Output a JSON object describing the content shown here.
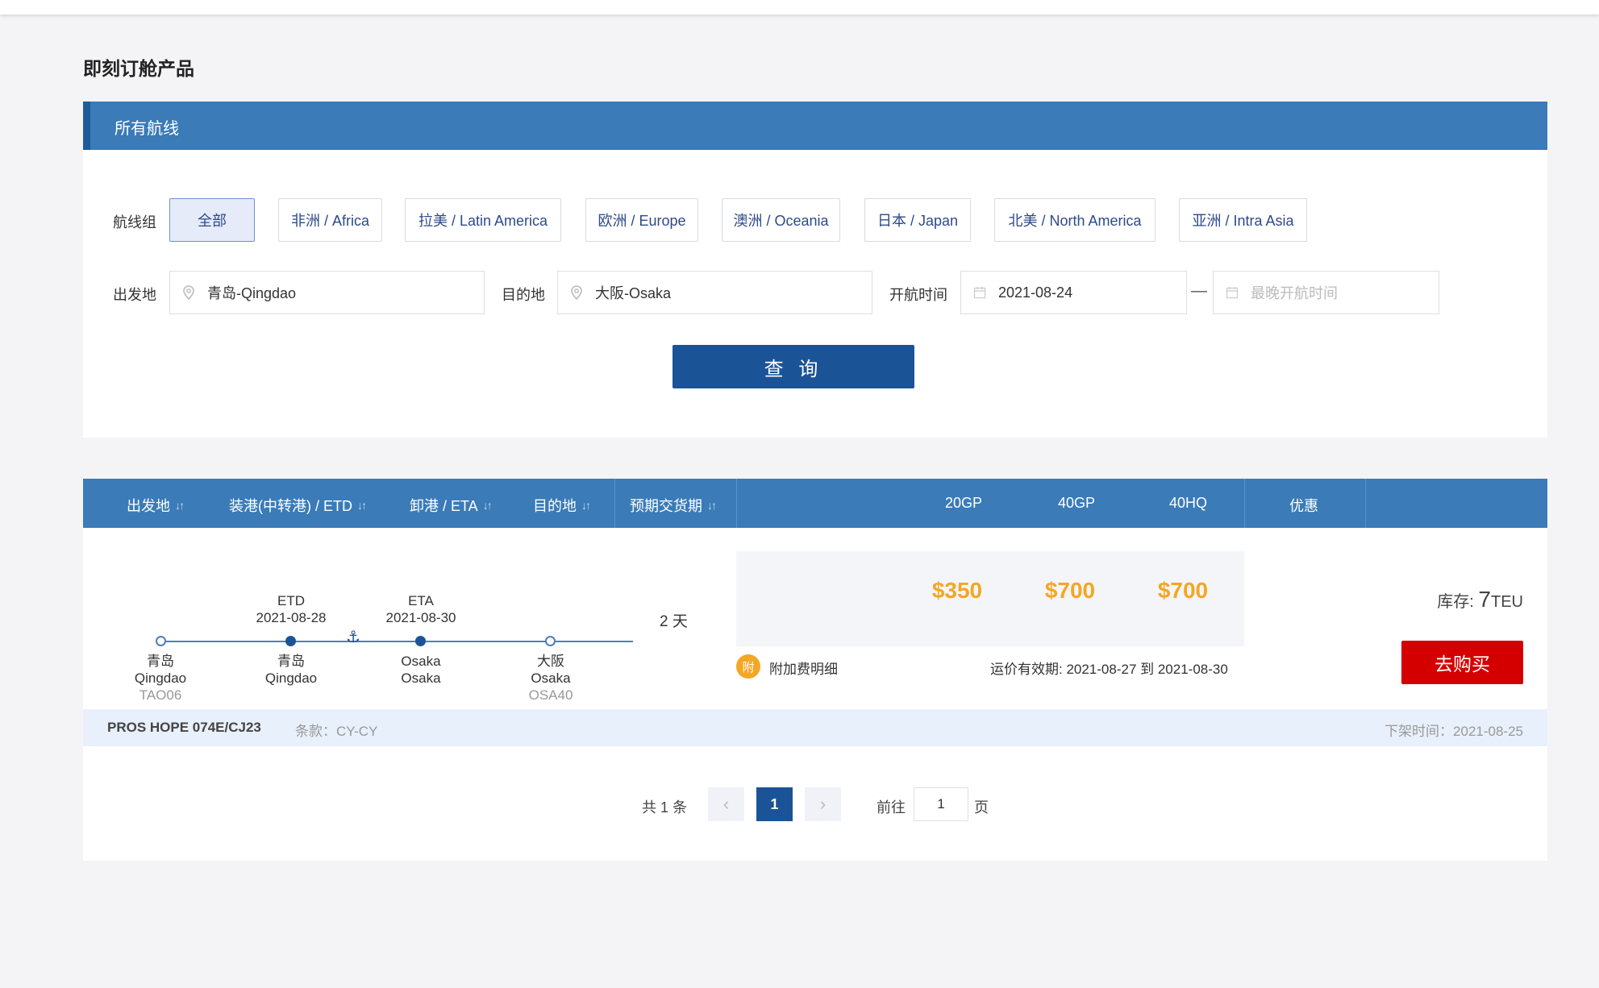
{
  "page": {
    "title": "即刻订舱产品"
  },
  "search": {
    "header": "所有航线",
    "group_label": "航线组",
    "groups": [
      "全部",
      "非洲 / Africa",
      "拉美 / Latin America",
      "欧洲 / Europe",
      "澳洲 / Oceania",
      "日本 / Japan",
      "北美 / North America",
      "亚洲 / Intra Asia"
    ],
    "origin_label": "出发地",
    "origin_value": "青岛-Qingdao",
    "dest_label": "目的地",
    "dest_value": "大阪-Osaka",
    "date_label": "开航时间",
    "date_from": "2021-08-24",
    "date_separator": "—",
    "date_to_placeholder": "最晚开航时间",
    "query_button": "查 询"
  },
  "table": {
    "headers": {
      "origin": "出发地",
      "load_port": "装港(中转港) / ETD",
      "discharge_port": "卸港 / ETA",
      "destination": "目的地",
      "transit": "预期交货期",
      "gp20": "20GP",
      "gp40": "40GP",
      "hq40": "40HQ",
      "discount": "优惠"
    },
    "sort_icon": "↓↑",
    "row": {
      "origin": {
        "cn": "青岛",
        "en": "Qingdao",
        "code": "TAO06"
      },
      "etd_label": "ETD",
      "etd_date": "2021-08-28",
      "load_port": {
        "cn": "青岛",
        "en": "Qingdao"
      },
      "eta_label": "ETA",
      "eta_date": "2021-08-30",
      "discharge_port": {
        "cn": "Osaka",
        "en": "Osaka"
      },
      "destination": {
        "cn": "大阪",
        "en": "Osaka",
        "code": "OSA40"
      },
      "transit": "2 天",
      "prices": {
        "gp20": "$350",
        "gp40": "$700",
        "hq40": "$700"
      },
      "fee_badge": "附",
      "fee_link": "附加费明细",
      "validity": "运价有效期: 2021-08-27 到 2021-08-30",
      "stock_label": "库存: ",
      "stock_num": "7",
      "stock_unit": "TEU",
      "buy_button": "去购买",
      "vessel": "PROS HOPE 074E/CJ23",
      "terms": "条款：CY-CY",
      "offline": "下架时间：2021-08-25"
    }
  },
  "pagination": {
    "total": "共 1 条",
    "prev": "‹",
    "current": "1",
    "next": "›",
    "goto_label": "前往",
    "goto_value": "1",
    "page_suffix": "页"
  },
  "colors": {
    "primary": "#3a7bb8",
    "dark": "#1b5496",
    "price": "#f5a623",
    "buy": "#d40000"
  }
}
